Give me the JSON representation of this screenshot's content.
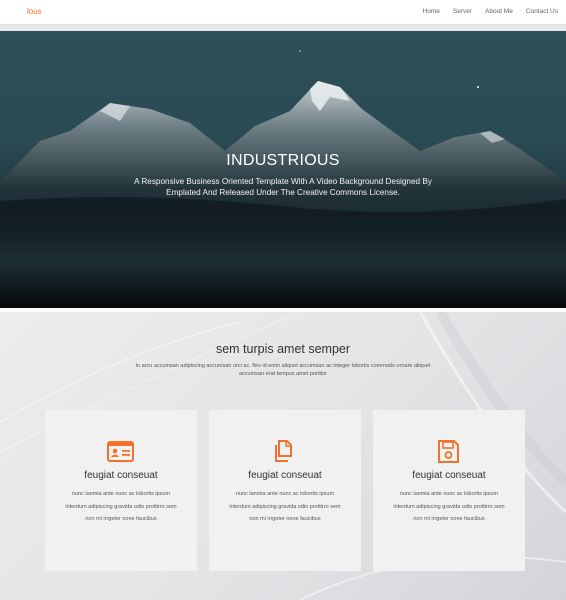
{
  "header": {
    "logo": "lous",
    "nav": [
      {
        "label": "Home"
      },
      {
        "label": "Server"
      },
      {
        "label": "About Me"
      },
      {
        "label": "Contact Us"
      }
    ]
  },
  "hero": {
    "title": "INDUSTRIOUS",
    "subtitle": "A Responsive Business Oriented Template With A Video Background Designed By Emplated And Released Under The Creative Commons License."
  },
  "section": {
    "title": "sem turpis amet semper",
    "text": "in arcu accumsan adipiscing accumsan orci ac. fles id enim aliquet accumsan ac integer lobortis commodo ornare aliquet accumsan erat tempus amet porttior"
  },
  "cards": [
    {
      "icon": "id-card-icon",
      "title": "feugiat conseuat",
      "text": "nunc lanmia ante nunc ac lobortis ipsum interdum adipiscing gravida odio prottirro sem non mi irrgeter none faucibus"
    },
    {
      "icon": "copy-icon",
      "title": "feugiat conseuat",
      "text": "nunc lanmia ante nunc ac lobortis ipsum interdum adipiscing gravida odio prottirro sem non mi irrgeter none faucibus"
    },
    {
      "icon": "save-icon",
      "title": "feugiat conseuat",
      "text": "nunc lanmia ante nunc ac lobortis ipsum interdum adipiscing gravida odio prottirro sem non mi irrgeter none faucibus"
    }
  ],
  "colors": {
    "accent": "#f2722c"
  }
}
